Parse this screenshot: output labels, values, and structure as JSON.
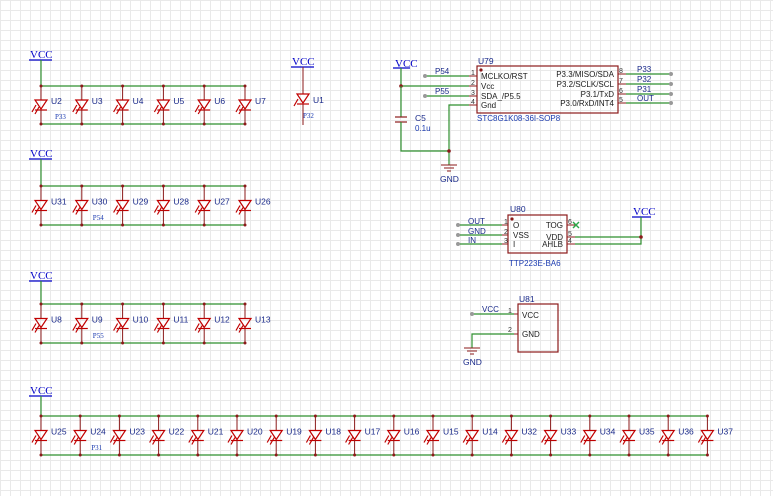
{
  "power_labels": {
    "vcc": "VCC",
    "gnd": "GND"
  },
  "led_rows": [
    {
      "leds": [
        "U2",
        "U3",
        "U4",
        "U5",
        "U6",
        "U7"
      ],
      "net": "P33",
      "net_after": 0
    },
    {
      "leds": [
        "U31",
        "U30",
        "U29",
        "U28",
        "U27",
        "U26"
      ],
      "net": "P54",
      "net_after": 1
    },
    {
      "leds": [
        "U8",
        "U9",
        "U10",
        "U11",
        "U12",
        "U13"
      ],
      "net": "P55",
      "net_after": 1
    },
    {
      "leds": [
        "U25",
        "U24",
        "U23",
        "U22",
        "U21",
        "U20",
        "U19",
        "U18",
        "U17",
        "U16",
        "U15",
        "U14",
        "U32",
        "U33",
        "U34",
        "U35",
        "U36",
        "U37"
      ],
      "net": "P31",
      "net_after": 1
    }
  ],
  "single_led": {
    "ref": "U1",
    "net": "P32"
  },
  "mcu": {
    "ref": "U79",
    "part": "STC8G1K08-36I-SOP8",
    "left_pins": [
      {
        "num": "1",
        "name": "MCLKO/RST",
        "net": "P54"
      },
      {
        "num": "2",
        "name": "Vcc",
        "net": ""
      },
      {
        "num": "3",
        "name": "SDA_/P5.5",
        "net": "P55"
      },
      {
        "num": "4",
        "name": "Gnd",
        "net": ""
      }
    ],
    "right_pins": [
      {
        "num": "8",
        "name": "P3.3/MISO/SDA",
        "net": "P33"
      },
      {
        "num": "7",
        "name": "P3.2/SCLK/SCL",
        "net": "P32"
      },
      {
        "num": "6",
        "name": "P3.1/TxD",
        "net": "P31"
      },
      {
        "num": "5",
        "name": "P3.0/RxD/INT4",
        "net": "OUT"
      }
    ]
  },
  "cap": {
    "ref": "C5",
    "value": "0.1u"
  },
  "touch": {
    "ref": "U80",
    "part": "TTP223E-BA6",
    "left_pins": [
      {
        "num": "1",
        "name": "O",
        "net": "OUT"
      },
      {
        "num": "2",
        "name": "VSS",
        "net": "GND"
      },
      {
        "num": "3",
        "name": "I",
        "net": "IN"
      }
    ],
    "right_pins": [
      {
        "num": "6",
        "name": "TOG"
      },
      {
        "num": "5",
        "name": "VDD"
      },
      {
        "num": "4",
        "name": "AHLB"
      }
    ]
  },
  "conn": {
    "ref": "U81",
    "pins": [
      {
        "num": "1",
        "name": "VCC",
        "net": "VCC"
      },
      {
        "num": "2",
        "name": "GND",
        "net": ""
      }
    ]
  }
}
